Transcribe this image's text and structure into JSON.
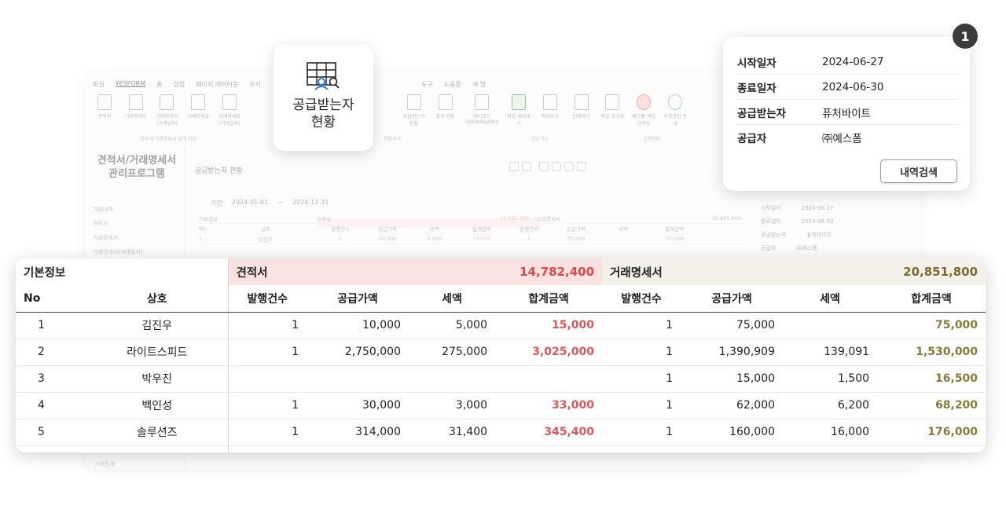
{
  "background_app": {
    "menu": [
      "파일",
      "YESFORM",
      "홈",
      "삽입",
      "페이지 레이아웃",
      "수식",
      "도구",
      "도움말",
      "새 탭"
    ],
    "ribbon_buttons": [
      "견적서",
      "거래명세서",
      "거래명세서 (거래일자)",
      "거래명세표",
      "거래명세표 (거래일자)",
      "공급받는자 현황",
      "월간 현황",
      "대시보드 (DASHBOARD)",
      "파일 내보내기",
      "미리보기",
      "인쇄하기",
      "파일 초기화",
      "예스폼 엑셀공작소",
      "사용방법 안내"
    ],
    "ribbon_groups": [
      "견적서/거래명세서 내역 작성",
      "현황검색",
      "관리기능",
      "고객센터"
    ],
    "app_title_line1": "견적서/거래명세서",
    "app_title_line2": "관리프로그램",
    "side_items": [
      "거래내역",
      "견적서",
      "거래명세서",
      "거래명세서(거래일자)"
    ],
    "side_bottom": "거래명세",
    "content_title": "공급받는자 현황",
    "period_label": "기간",
    "period_start": "2024-01-01",
    "period_tilde": "~",
    "period_end": "2024-12-31",
    "mini_basic": "기본정보",
    "mini_est": "견적서",
    "mini_est_total": "14,782,400",
    "mini_stmt": "거래명세서",
    "mini_stmt_total": "20,851,800",
    "mini_headers": [
      "No",
      "상호",
      "발행건수",
      "공급가액",
      "세액",
      "합계금액",
      "발행건수",
      "공급가액",
      "세액",
      "합계금액"
    ],
    "mini_row": [
      "1",
      "김진우",
      "1",
      "10,000",
      "5,000",
      "15,000",
      "1",
      "75,000",
      "",
      "75,000"
    ],
    "right_mini": [
      {
        "k": "시작일자",
        "v": "2024-06-27"
      },
      {
        "k": "종료일자",
        "v": "2024-06-30"
      },
      {
        "k": "공급받는자",
        "v": "퓨처바이트"
      },
      {
        "k": "공급자",
        "v": "㈜예스폼"
      }
    ]
  },
  "icon_card": {
    "icon": "table-person-search-icon",
    "line1": "공급받는자",
    "line2": "현황"
  },
  "search_card": {
    "badge": "1",
    "fields": [
      {
        "label": "시작일자",
        "value": "2024-06-27"
      },
      {
        "label": "종료일자",
        "value": "2024-06-30"
      },
      {
        "label": "공급받는자",
        "value": "퓨처바이트"
      },
      {
        "label": "공급자",
        "value": "㈜예스폼"
      }
    ],
    "button_label": "내역검색"
  },
  "main_table": {
    "groups": {
      "basic": "기본정보",
      "estimate": "견적서",
      "estimate_total": "14,782,400",
      "statement": "거래명세서",
      "statement_total": "20,851,800"
    },
    "headers": [
      "No",
      "상호",
      "발행건수",
      "공급가액",
      "세액",
      "합계금액",
      "발행건수",
      "공급가액",
      "세액",
      "합계금액"
    ],
    "rows": [
      [
        "1",
        "김진우",
        "1",
        "10,000",
        "5,000",
        "15,000",
        "1",
        "75,000",
        "",
        "75,000"
      ],
      [
        "2",
        "라이트스피드",
        "1",
        "2,750,000",
        "275,000",
        "3,025,000",
        "1",
        "1,390,909",
        "139,091",
        "1,530,000"
      ],
      [
        "3",
        "박우진",
        "",
        "",
        "",
        "",
        "1",
        "15,000",
        "1,500",
        "16,500"
      ],
      [
        "4",
        "백인성",
        "1",
        "30,000",
        "3,000",
        "33,000",
        "1",
        "62,000",
        "6,200",
        "68,200"
      ],
      [
        "5",
        "솔루션즈",
        "1",
        "314,000",
        "31,400",
        "345,400",
        "1",
        "160,000",
        "16,000",
        "176,000"
      ]
    ]
  },
  "colors": {
    "estimate_accent": "#e05555",
    "statement_accent": "#8a7a38",
    "estimate_header_bg": "#fbe2e2",
    "statement_header_bg": "#f3f1ea"
  }
}
